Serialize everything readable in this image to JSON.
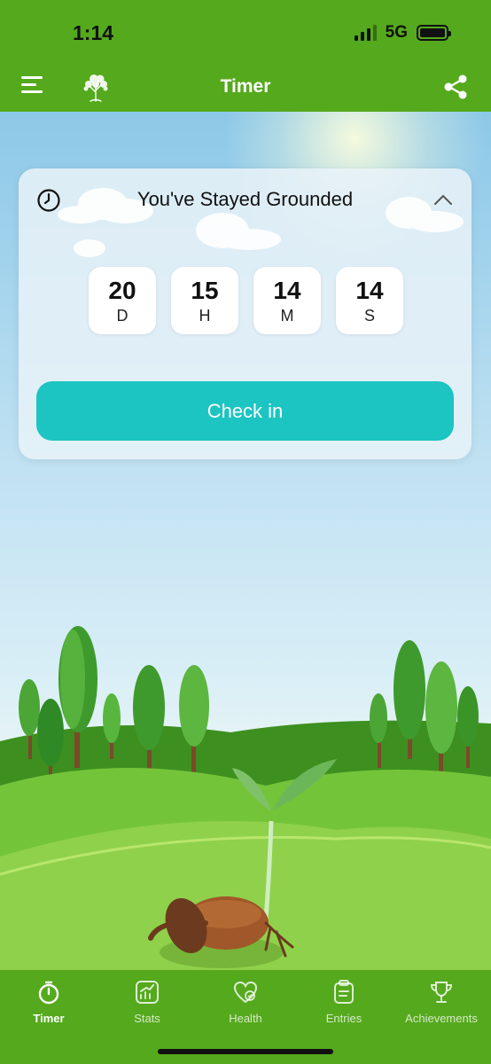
{
  "status_bar": {
    "time": "1:14",
    "network": "5G"
  },
  "header": {
    "title": "Timer",
    "menu_icon": "menu-icon",
    "logo_icon": "tree-logo-icon",
    "share_icon": "share-icon"
  },
  "card": {
    "title": "You've Stayed Grounded",
    "counters": [
      {
        "value": "20",
        "unit": "D"
      },
      {
        "value": "15",
        "unit": "H"
      },
      {
        "value": "14",
        "unit": "M"
      },
      {
        "value": "14",
        "unit": "S"
      }
    ],
    "check_in_label": "Check in"
  },
  "tabs": [
    {
      "label": "Timer",
      "icon": "stopwatch-icon",
      "active": true
    },
    {
      "label": "Stats",
      "icon": "chart-icon",
      "active": false
    },
    {
      "label": "Health",
      "icon": "heart-icon",
      "active": false
    },
    {
      "label": "Entries",
      "icon": "clipboard-icon",
      "active": false
    },
    {
      "label": "Achievements",
      "icon": "trophy-icon",
      "active": false
    }
  ],
  "colors": {
    "brand_green": "#55a91d",
    "accent_teal": "#1cc4c2"
  }
}
